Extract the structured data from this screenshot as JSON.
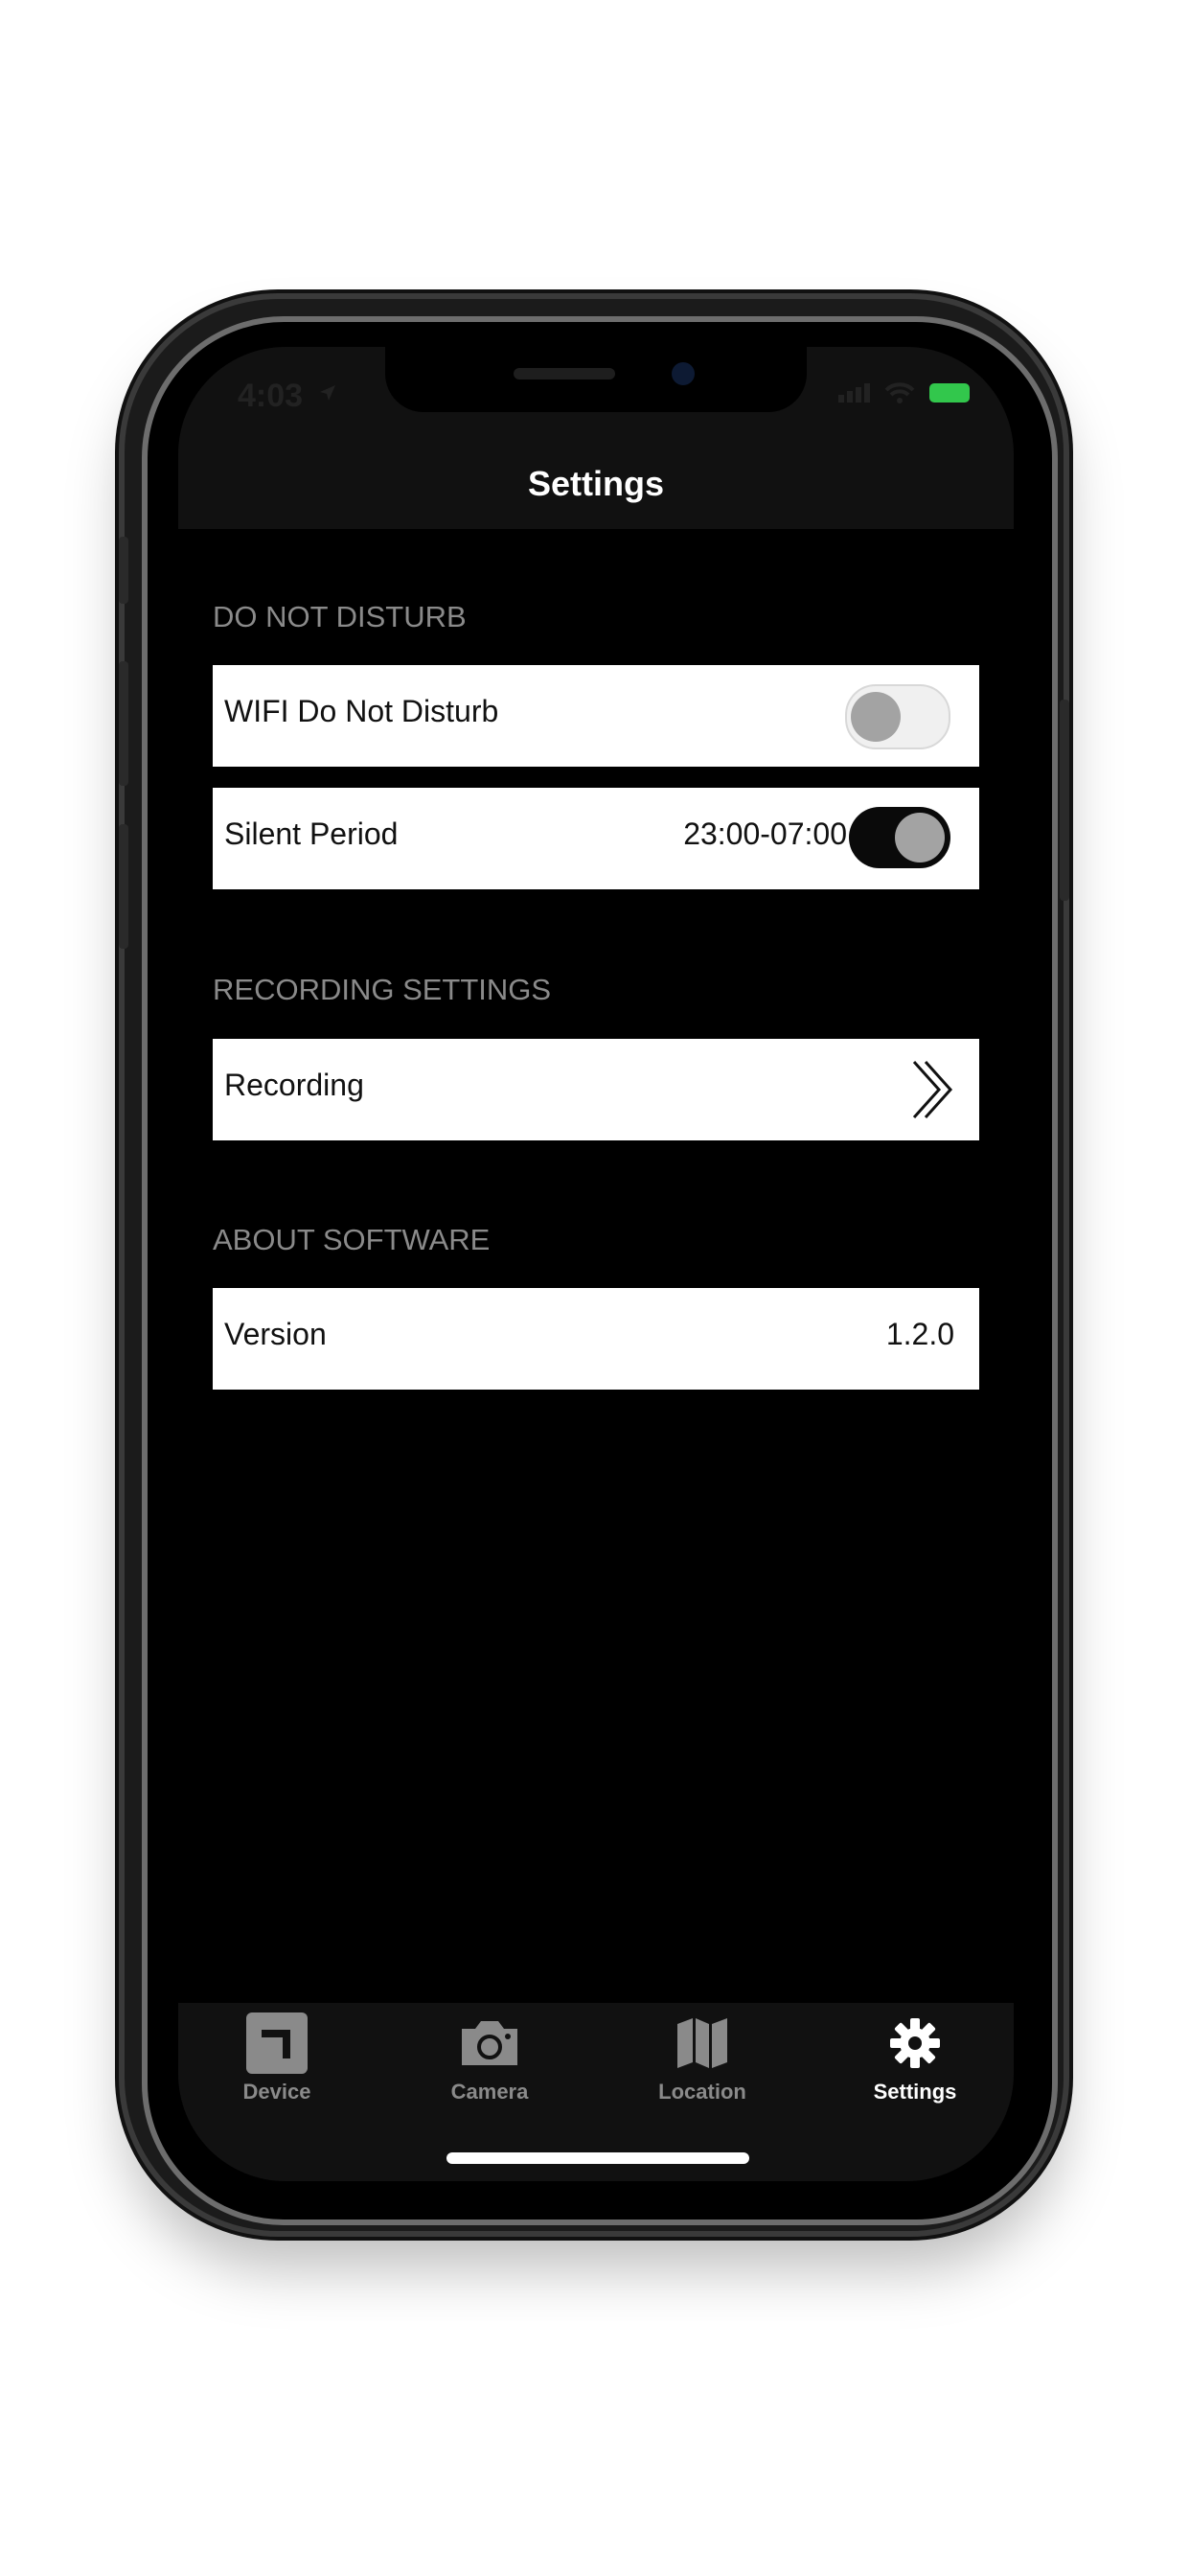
{
  "status": {
    "time": "4:03"
  },
  "nav": {
    "title": "Settings"
  },
  "sections": {
    "dnd": {
      "header": "DO NOT DISTURB",
      "wifi_label": "WIFI Do Not Disturb",
      "wifi_enabled": false,
      "silent_label": "Silent Period",
      "silent_value": "23:00-07:00",
      "silent_enabled": true
    },
    "recording": {
      "header": "RECORDING SETTINGS",
      "row_label": "Recording"
    },
    "about": {
      "header": "ABOUT SOFTWARE",
      "version_label": "Version",
      "version_value": "1.2.0"
    }
  },
  "tabs": [
    {
      "label": "Device",
      "icon": "device-icon",
      "active": false
    },
    {
      "label": "Camera",
      "icon": "camera-icon",
      "active": false
    },
    {
      "label": "Location",
      "icon": "map-icon",
      "active": false
    },
    {
      "label": "Settings",
      "icon": "gear-icon",
      "active": true
    }
  ],
  "colors": {
    "battery": "#32c74c",
    "inactive_tab": "#8a8a8a",
    "active_tab": "#ffffff"
  }
}
